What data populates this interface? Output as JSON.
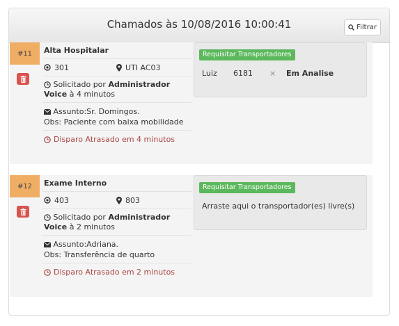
{
  "header": {
    "title": "Chamados às 10/08/2016 10:00:41",
    "filter_label": "Filtrar"
  },
  "tickets": [
    {
      "number": "#11",
      "title": "Alta Hospitalar",
      "room": "301",
      "location": "UTI AC03",
      "requested_prefix": "Solicitado por ",
      "requested_by": "Administrador Voice",
      "requested_suffix": " à 4 minutos",
      "subject": "Assunto:Sr. Domingos.",
      "obs": "Obs: Paciente com baixa mobilidade",
      "delay": "Disparo Atrasado em 4 minutos",
      "request_button": "Requisitar Transportadores",
      "transporter": {
        "name": "Luiz",
        "code": "6181",
        "remove": "×",
        "status": "Em Analise"
      }
    },
    {
      "number": "#12",
      "title": "Exame Interno",
      "room": "403",
      "location": "803",
      "requested_prefix": "Solicitado por ",
      "requested_by": "Administrador Voice",
      "requested_suffix": " à 2 minutos",
      "subject": "Assunto:Adriana.",
      "obs": "Obs: Transferência de quarto",
      "delay": "Disparo Atrasado em 2 minutos",
      "request_button": "Requisitar Transportadores",
      "drop_hint": "Arraste aqui o transportador(es) livre(s)"
    }
  ],
  "colors": {
    "badge": "#f0ad64",
    "delete": "#d9534f",
    "request": "#5cb85c",
    "delay_text": "#a94442"
  }
}
